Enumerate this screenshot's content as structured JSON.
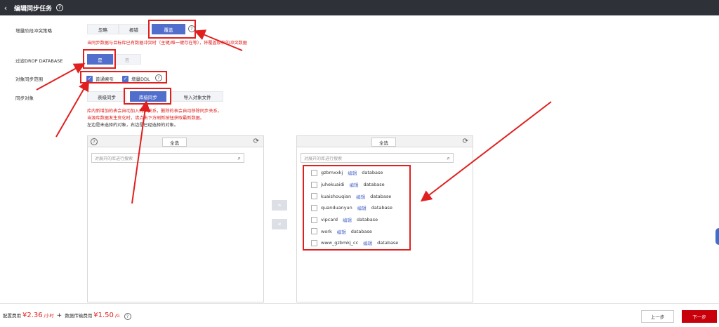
{
  "header": {
    "back": "‹",
    "title": "编辑同步任务",
    "help": "?"
  },
  "conflict": {
    "label": "增量阶段冲突策略",
    "options": [
      "忽略",
      "报错",
      "覆盖"
    ],
    "active": 2,
    "note": "当同步数据与目标库已有数据冲突时（主键/唯一键存在等），将覆盖原来的冲突数据"
  },
  "drop": {
    "label": "过滤DROP DATABASE",
    "options": [
      "是",
      "否"
    ],
    "active": 0
  },
  "scope": {
    "label": "对象同步范围",
    "items": [
      {
        "label": "普通索引",
        "checked": true
      },
      {
        "label": "增量DDL",
        "checked": true
      }
    ]
  },
  "sync_object": {
    "label": "同步对象",
    "options": [
      "表级同步",
      "库级同步",
      "导入对象文件"
    ],
    "active": 1,
    "notes": [
      "库内新增加的表会自动加入同步关系，删除的表会自动移除同步关系。",
      "当源库数据发生变化时，请点击下方刷新按钮获取最新数据。",
      "左边是未选择的对象，右边是已经选择的对象。"
    ]
  },
  "left_panel": {
    "help": "?",
    "select_all": "全选",
    "search_placeholder": "对展开的库进行搜索"
  },
  "right_panel": {
    "select_all": "全选",
    "search_placeholder": "对展开的库进行搜索",
    "items": [
      {
        "name": "gzbmxxkj",
        "edit": "编辑",
        "type": "database"
      },
      {
        "name": "juhekuaidi",
        "edit": "编辑",
        "type": "database"
      },
      {
        "name": "kuaishouqian",
        "edit": "编辑",
        "type": "database"
      },
      {
        "name": "quanduanyun",
        "edit": "编辑",
        "type": "database"
      },
      {
        "name": "vipcard",
        "edit": "编辑",
        "type": "database"
      },
      {
        "name": "work",
        "edit": "编辑",
        "type": "database"
      },
      {
        "name": "www_gzbmkj_cc",
        "edit": "编辑",
        "type": "database"
      }
    ]
  },
  "transfer": {
    "add": "»",
    "remove": "«"
  },
  "footer": {
    "config_label": "配置费用",
    "config_price": "¥2.36",
    "config_unit": "/小时",
    "plus": "+",
    "transfer_label": "数据传输费用",
    "transfer_price": "¥1.50",
    "transfer_unit": "/G",
    "help": "?",
    "prev": "上一步",
    "next": "下一步"
  },
  "colors": {
    "accent": "#526ecc",
    "highlight": "#e0201f",
    "primary_button": "#c7000b",
    "header": "#2e3138"
  }
}
